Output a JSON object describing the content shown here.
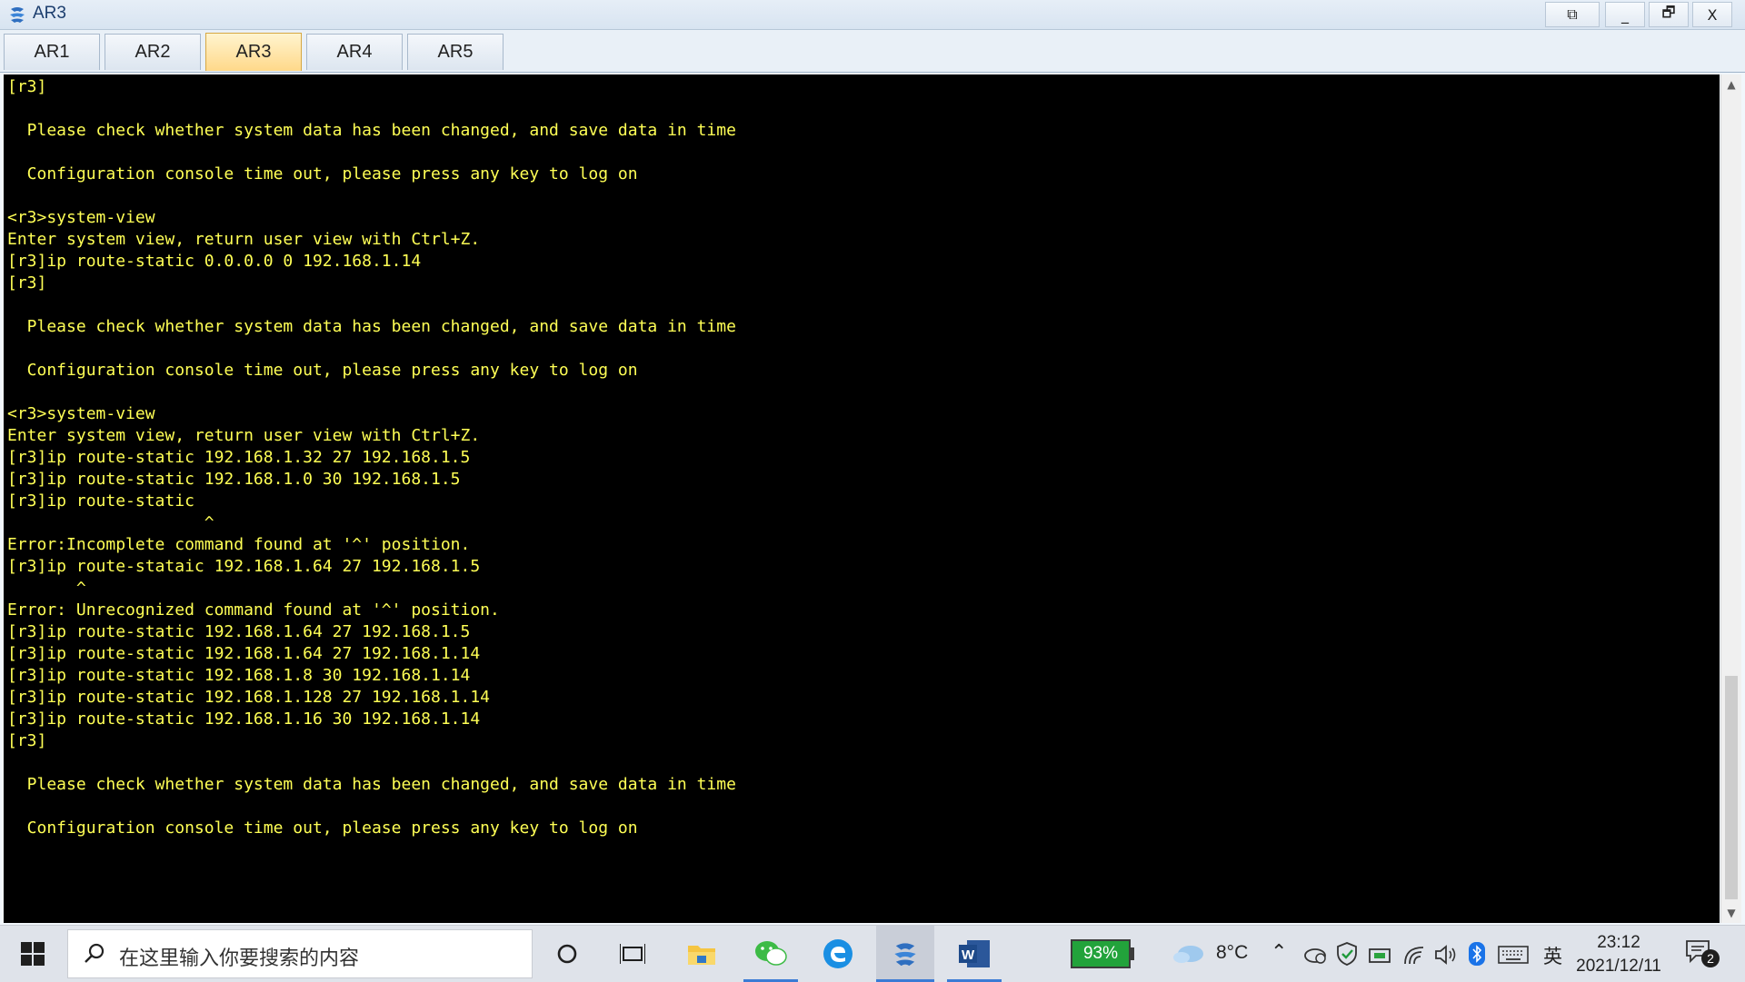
{
  "window": {
    "title": "AR3",
    "buttons": [
      "⧉",
      "_",
      "🗗",
      "X"
    ]
  },
  "tabs": [
    {
      "label": "AR1",
      "active": false
    },
    {
      "label": "AR2",
      "active": false
    },
    {
      "label": "AR3",
      "active": true
    },
    {
      "label": "AR4",
      "active": false
    },
    {
      "label": "AR5",
      "active": false
    }
  ],
  "terminal": {
    "lines": [
      "[r3]",
      "",
      "  Please check whether system data has been changed, and save data in time",
      "",
      "  Configuration console time out, please press any key to log on",
      "",
      "<r3>system-view",
      "Enter system view, return user view with Ctrl+Z.",
      "[r3]ip route-static 0.0.0.0 0 192.168.1.14",
      "[r3]",
      "",
      "  Please check whether system data has been changed, and save data in time",
      "",
      "  Configuration console time out, please press any key to log on",
      "",
      "<r3>system-view",
      "Enter system view, return user view with Ctrl+Z.",
      "[r3]ip route-static 192.168.1.32 27 192.168.1.5",
      "[r3]ip route-static 192.168.1.0 30 192.168.1.5",
      "[r3]ip route-static",
      "                    ^",
      "Error:Incomplete command found at '^' position.",
      "[r3]ip route-stataic 192.168.1.64 27 192.168.1.5",
      "       ^",
      "Error: Unrecognized command found at '^' position.",
      "[r3]ip route-static 192.168.1.64 27 192.168.1.5",
      "[r3]ip route-static 192.168.1.64 27 192.168.1.14",
      "[r3]ip route-static 192.168.1.8 30 192.168.1.14",
      "[r3]ip route-static 192.168.1.128 27 192.168.1.14",
      "[r3]ip route-static 192.168.1.16 30 192.168.1.14",
      "[r3]",
      "",
      "  Please check whether system data has been changed, and save data in time",
      "",
      "  Configuration console time out, please press any key to log on"
    ]
  },
  "taskbar": {
    "search_placeholder": "在这里输入你要搜索的内容",
    "battery": "93%",
    "temperature": "8°C",
    "ime": "英",
    "time": "23:12",
    "date": "2021/12/11",
    "notification_count": "2"
  },
  "colors": {
    "terminal_bg": "#000000",
    "terminal_fg": "#ffff55",
    "active_tab": "#ffd98a",
    "battery": "#22a33b"
  }
}
